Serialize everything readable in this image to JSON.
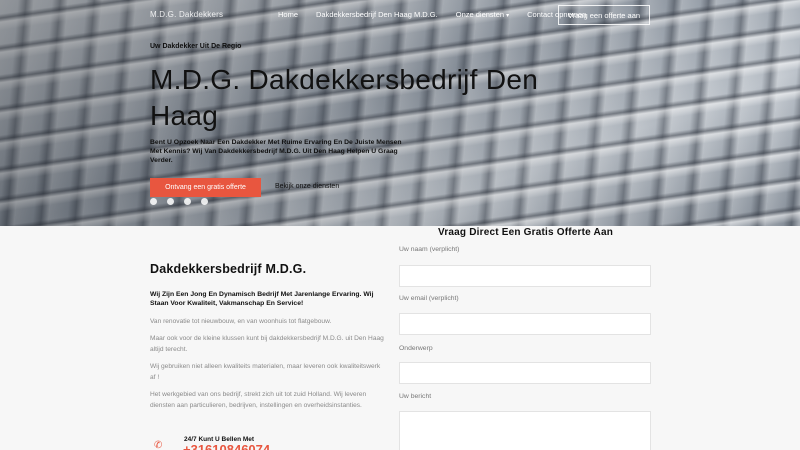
{
  "nav": {
    "logo": "M.D.G. Dakdekkers",
    "links": [
      "Home",
      "Dakdekkersbedrijf Den Haag M.D.G.",
      "Onze diensten",
      "Contact opnemen"
    ],
    "cta": "Vraag een offerte aan"
  },
  "hero": {
    "eyebrow": "Uw Dakdekker Uit De Regio",
    "title": "M.D.G. Dakdekkersbedrijf Den Haag",
    "subtitle": "Bent U Opzoek Naar Een Dakdekker Met Ruime Ervaring En De Juiste Mensen Met Kennis? Wij Van Dakdekkersbedrijf M.D.G. Uit Den Haag Helpen U Graag Verder.",
    "primary_button": "Ontvang een gratis offerte",
    "secondary_link": "Bekijk onze diensten",
    "socials": [
      "facebook-icon",
      "twitter-icon",
      "youtube-icon",
      "instagram-icon"
    ]
  },
  "content": {
    "title": "Dakdekkersbedrijf M.D.G.",
    "lead": "Wij Zijn Een Jong En Dynamisch Bedrijf Met Jarenlange Ervaring. Wij Staan Voor Kwaliteit, Vakmanschap En Service!",
    "paragraphs": [
      "Van renovatie tot nieuwbouw, en van woonhuis tot flatgebouw.",
      "Maar ook voor de kleine klussen kunt bij dakdekkersbedrijf M.D.G. uit Den Haag altijd terecht.",
      "Wij gebruiken niet alleen kwaliteits materialen, maar leveren ook kwaliteitswerk af !",
      "Het werkgebied van ons bedrijf, strekt zich uit tot zuid Holland. Wij leveren diensten aan particulieren, bedrijven, instellingen en overheidsinstanties."
    ],
    "phone_label": "24/7 Kunt U Bellen Met",
    "phone_number": "+31610846074"
  },
  "form": {
    "title": "Vraag Direct Een Gratis Offerte Aan",
    "fields": [
      {
        "label": "Uw naam (verplicht)",
        "value": ""
      },
      {
        "label": "Uw email (verplicht)",
        "value": ""
      },
      {
        "label": "Onderwerp",
        "value": ""
      },
      {
        "label": "Uw bericht",
        "value": ""
      }
    ]
  },
  "colors": {
    "accent": "#e8563f",
    "muted_text": "#8a8a8a"
  }
}
